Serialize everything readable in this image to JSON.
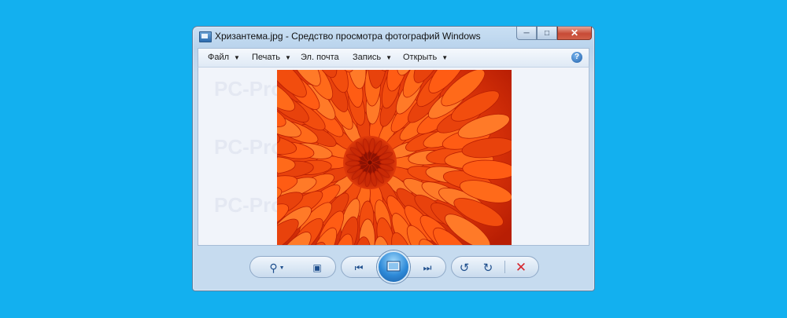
{
  "window": {
    "title": "Хризантема.jpg - Средство просмотра фотографий Windows"
  },
  "menu": {
    "items": [
      {
        "label": "Файл"
      },
      {
        "label": "Печать"
      },
      {
        "label": "Эл. почта"
      },
      {
        "label": "Запись"
      },
      {
        "label": "Открыть"
      }
    ],
    "help_icon": "help-icon"
  },
  "watermark": {
    "text": "PC-Problems.RU"
  },
  "photo": {
    "subject": "chrysanthemum",
    "color": "#d72a05"
  },
  "toolbar": {
    "icons": [
      "zoom-icon",
      "actual-size-icon",
      "previous-icon",
      "slideshow-icon",
      "next-icon",
      "rotate-left-icon",
      "rotate-right-icon",
      "delete-icon"
    ]
  },
  "colors": {
    "background": "#13b0ef",
    "delete": "#d6262d",
    "accent": "#1f4f8d"
  }
}
